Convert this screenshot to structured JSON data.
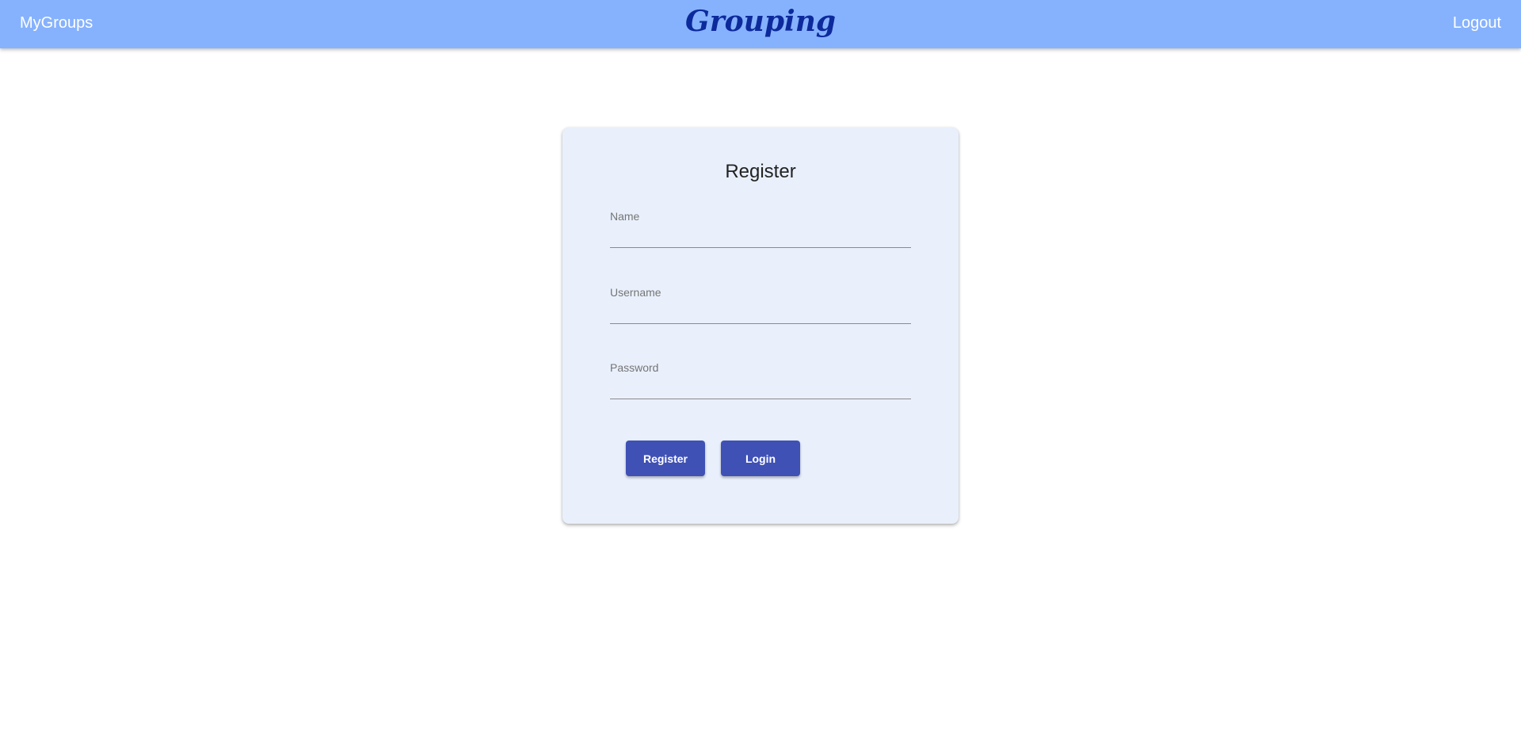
{
  "navbar": {
    "left_link": "MyGroups",
    "brand": "Grouping",
    "right_link": "Logout",
    "background": "#86b2fd",
    "brand_color": "#0d2a9c"
  },
  "card": {
    "title": "Register",
    "background": "#e9f0fc",
    "fields": [
      {
        "label": "Name",
        "value": ""
      },
      {
        "label": "Username",
        "value": ""
      },
      {
        "label": "Password",
        "value": ""
      }
    ],
    "buttons": {
      "register_label": "Register",
      "login_label": "Login",
      "color": "#3f51b5"
    }
  }
}
